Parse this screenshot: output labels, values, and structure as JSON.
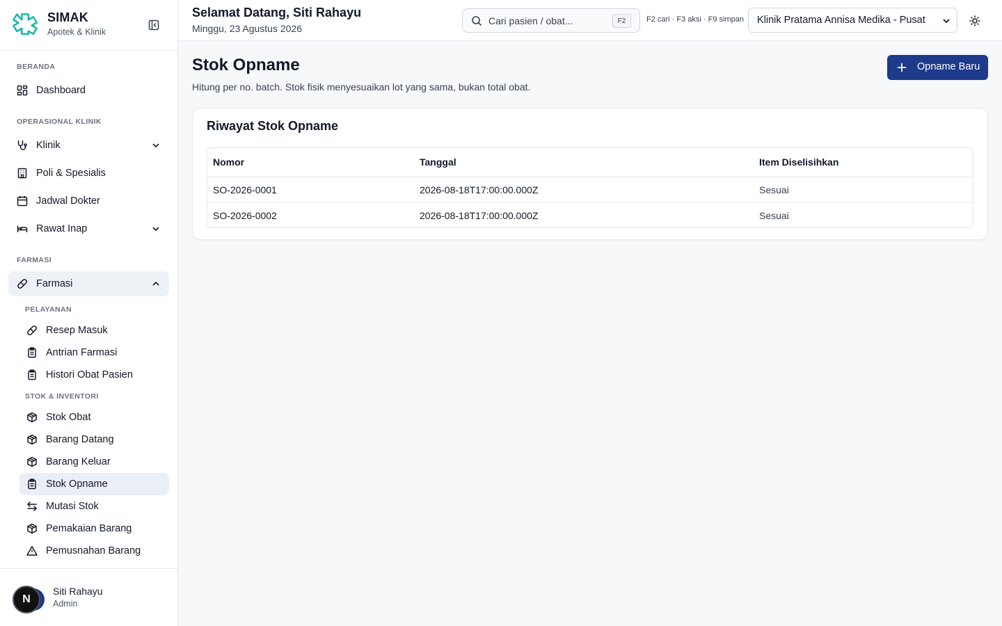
{
  "brand": {
    "name": "SIMAK",
    "subtitle": "Apotek & Klinik"
  },
  "sidebar": {
    "sections": {
      "beranda": "BERANDA",
      "operasional": "OPERASIONAL KLINIK",
      "farmasi": "FARMASI"
    },
    "items": {
      "dashboard": "Dashboard",
      "klinik": "Klinik",
      "poli": "Poli & Spesialis",
      "jadwal": "Jadwal Dokter",
      "rawat_inap": "Rawat Inap",
      "farmasi": "Farmasi"
    },
    "farmasi_groups": {
      "pelayanan": "PELAYANAN",
      "stok": "STOK & INVENTORI"
    },
    "farmasi_items": {
      "resep_masuk": "Resep Masuk",
      "antrian": "Antrian Farmasi",
      "histori": "Histori Obat Pasien",
      "stok_obat": "Stok Obat",
      "barang_datang": "Barang Datang",
      "barang_keluar": "Barang Keluar",
      "stok_opname": "Stok Opname",
      "mutasi": "Mutasi Stok",
      "pemakaian": "Pemakaian Barang",
      "pemusnahan": "Pemusnahan Barang"
    }
  },
  "user": {
    "initial": "N",
    "name": "Siti Rahayu",
    "role": "Admin"
  },
  "header": {
    "greeting": "Selamat Datang, Siti Rahayu",
    "date": "Minggu, 23 Agustus 2026",
    "search_placeholder": "Cari pasien / obat...",
    "search_kbd": "F2",
    "shortcut_hint": "F2 cari · F3 aksi · F9 simpan",
    "clinic_selected": "Klinik Pratama Annisa Medika - Pusat"
  },
  "page": {
    "title": "Stok Opname",
    "description": "Hitung per no. batch. Stok fisik menyesuaikan lot yang sama, bukan total obat.",
    "new_button": "Opname Baru"
  },
  "history": {
    "title": "Riwayat Stok Opname",
    "columns": {
      "nomor": "Nomor",
      "tanggal": "Tanggal",
      "selisih": "Item Diselisihkan"
    },
    "rows": [
      {
        "nomor": "SO-2026-0001",
        "tanggal": "2026-08-18T17:00:00.000Z",
        "selisih": "Sesuai"
      },
      {
        "nomor": "SO-2026-0002",
        "tanggal": "2026-08-18T17:00:00.000Z",
        "selisih": "Sesuai"
      }
    ]
  },
  "colors": {
    "primary": "#1e3a8a",
    "brand_teal": "#14b8a6",
    "active_bg": "#eaeef7"
  }
}
